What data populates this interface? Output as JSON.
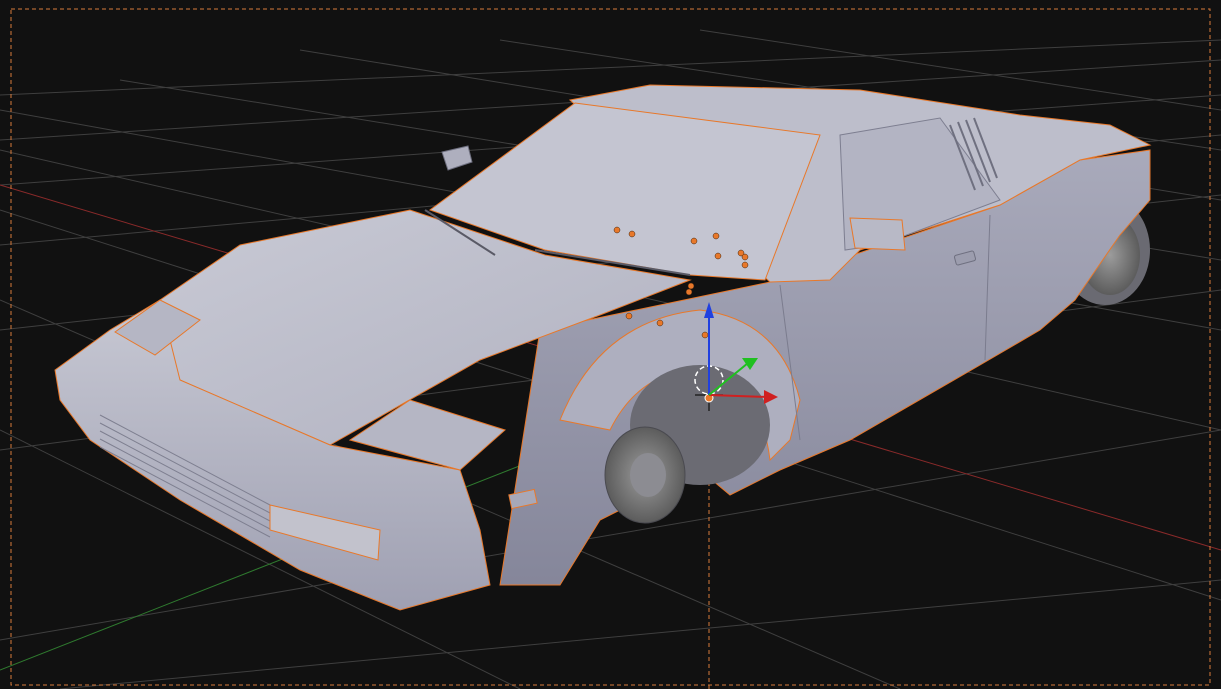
{
  "viewport": {
    "background": "#111111",
    "grid_color": "#4a4a4a",
    "axis_x_color": "#a83232",
    "axis_y_color": "#3a8a3a",
    "camera_frame_color": "#d87a3a",
    "selection_outline_color": "#e8782a",
    "model_color": "#b9bac6",
    "model_shadow_color": "#8e8fa0",
    "selected_object": "car-body"
  },
  "gizmo": {
    "x_axis_color": "#d02020",
    "y_axis_color": "#20c020",
    "z_axis_color": "#2040e0"
  },
  "icons": {
    "cursor": "3d-cursor-icon",
    "origin": "object-origin-icon",
    "gizmo": "transform-gizmo-icon"
  }
}
